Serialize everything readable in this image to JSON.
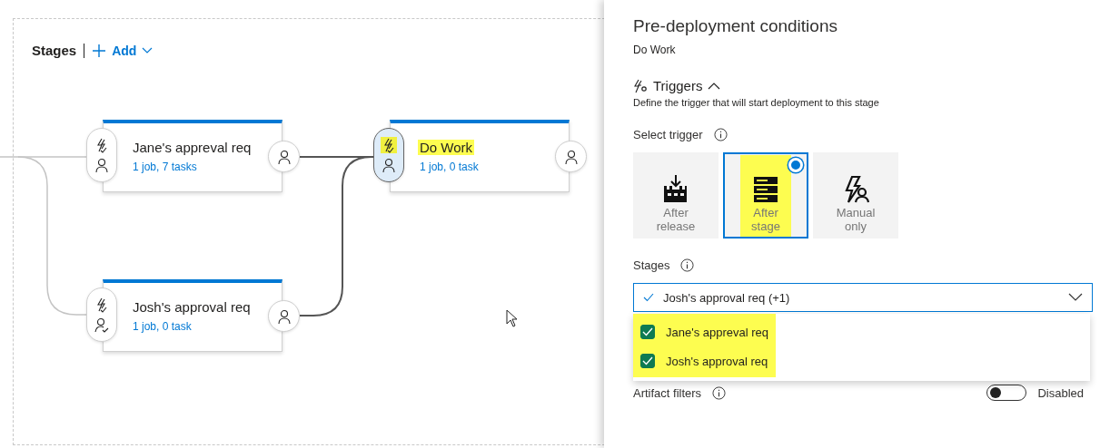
{
  "toolbar": {
    "title": "Stages",
    "add_label": "Add"
  },
  "stages": [
    {
      "name": "Jane's appreval req",
      "summary": "1 job, 7 tasks",
      "selected": false,
      "highlighted": false,
      "pre_approvers_set": false
    },
    {
      "name": "Do Work",
      "summary": "1 job, 0 task",
      "selected": true,
      "highlighted": true,
      "pre_approvers_set": false
    },
    {
      "name": "Josh's approval req",
      "summary": "1 job, 0 task",
      "selected": false,
      "highlighted": false,
      "pre_approvers_set": true
    }
  ],
  "panel": {
    "title": "Pre-deployment conditions",
    "subtitle": "Do Work",
    "section": {
      "title": "Triggers",
      "expanded": true,
      "description": "Define the trigger that will start deployment to this stage"
    },
    "select_trigger_label": "Select trigger",
    "trigger_options": [
      {
        "kind": "release",
        "label": "After release",
        "selected": false,
        "highlighted": false
      },
      {
        "kind": "stage",
        "label": "After stage",
        "selected": true,
        "highlighted": true
      },
      {
        "kind": "manual",
        "label": "Manual only",
        "selected": false,
        "highlighted": false
      }
    ],
    "stages_label": "Stages",
    "stages_dropdown": {
      "value": "Josh's approval req (+1)",
      "expanded": true,
      "highlighted": true,
      "items": [
        {
          "label": "Jane's appreval req",
          "checked": true
        },
        {
          "label": "Josh's approval req",
          "checked": true
        }
      ]
    },
    "artifact_filters": {
      "label": "Artifact filters",
      "on": false,
      "state_text": "Disabled"
    }
  }
}
